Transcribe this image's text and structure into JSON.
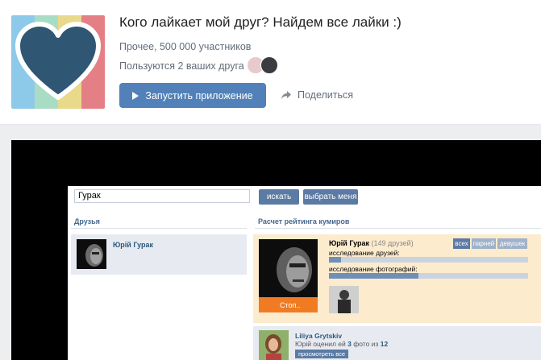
{
  "app": {
    "title": "Кого лайкает мой друг? Найдем все лайки :)",
    "category": "Прочее, 500 000 участников",
    "friends_using": "Пользуются 2 ваших друга",
    "launch_label": "Запустить приложение",
    "share_label": "Поделиться",
    "logo_colors": [
      "#8dc9e8",
      "#a9dcc5",
      "#e9d98b",
      "#e57f86"
    ],
    "heart_color": "#2f5673"
  },
  "embedded": {
    "search_value": "Гурак",
    "search_button": "искать",
    "choose_me_button": "выбрать меня",
    "friends_header": "Друзья",
    "rating_header": "Расчет рейтинга кумиров",
    "friend": {
      "name": "Юрій Гурак"
    },
    "rating": {
      "name": "Юрій Гурак",
      "friend_count": "(149 друзей)",
      "filters": [
        "всех",
        "парней",
        "девушек"
      ],
      "progress_friends_label": "исследование друзей:",
      "progress_friends": 0.06,
      "progress_photos_label": "исследование фотографий:",
      "progress_photos": 0.45,
      "stop_label": "Стоп.."
    },
    "liker": {
      "name": "Liliya Grytskiv",
      "desc_prefix": "Юрій оценил ей",
      "liked": "3",
      "desc_mid": "фото из",
      "total": "12",
      "view_all": "просмотреть все"
    }
  }
}
